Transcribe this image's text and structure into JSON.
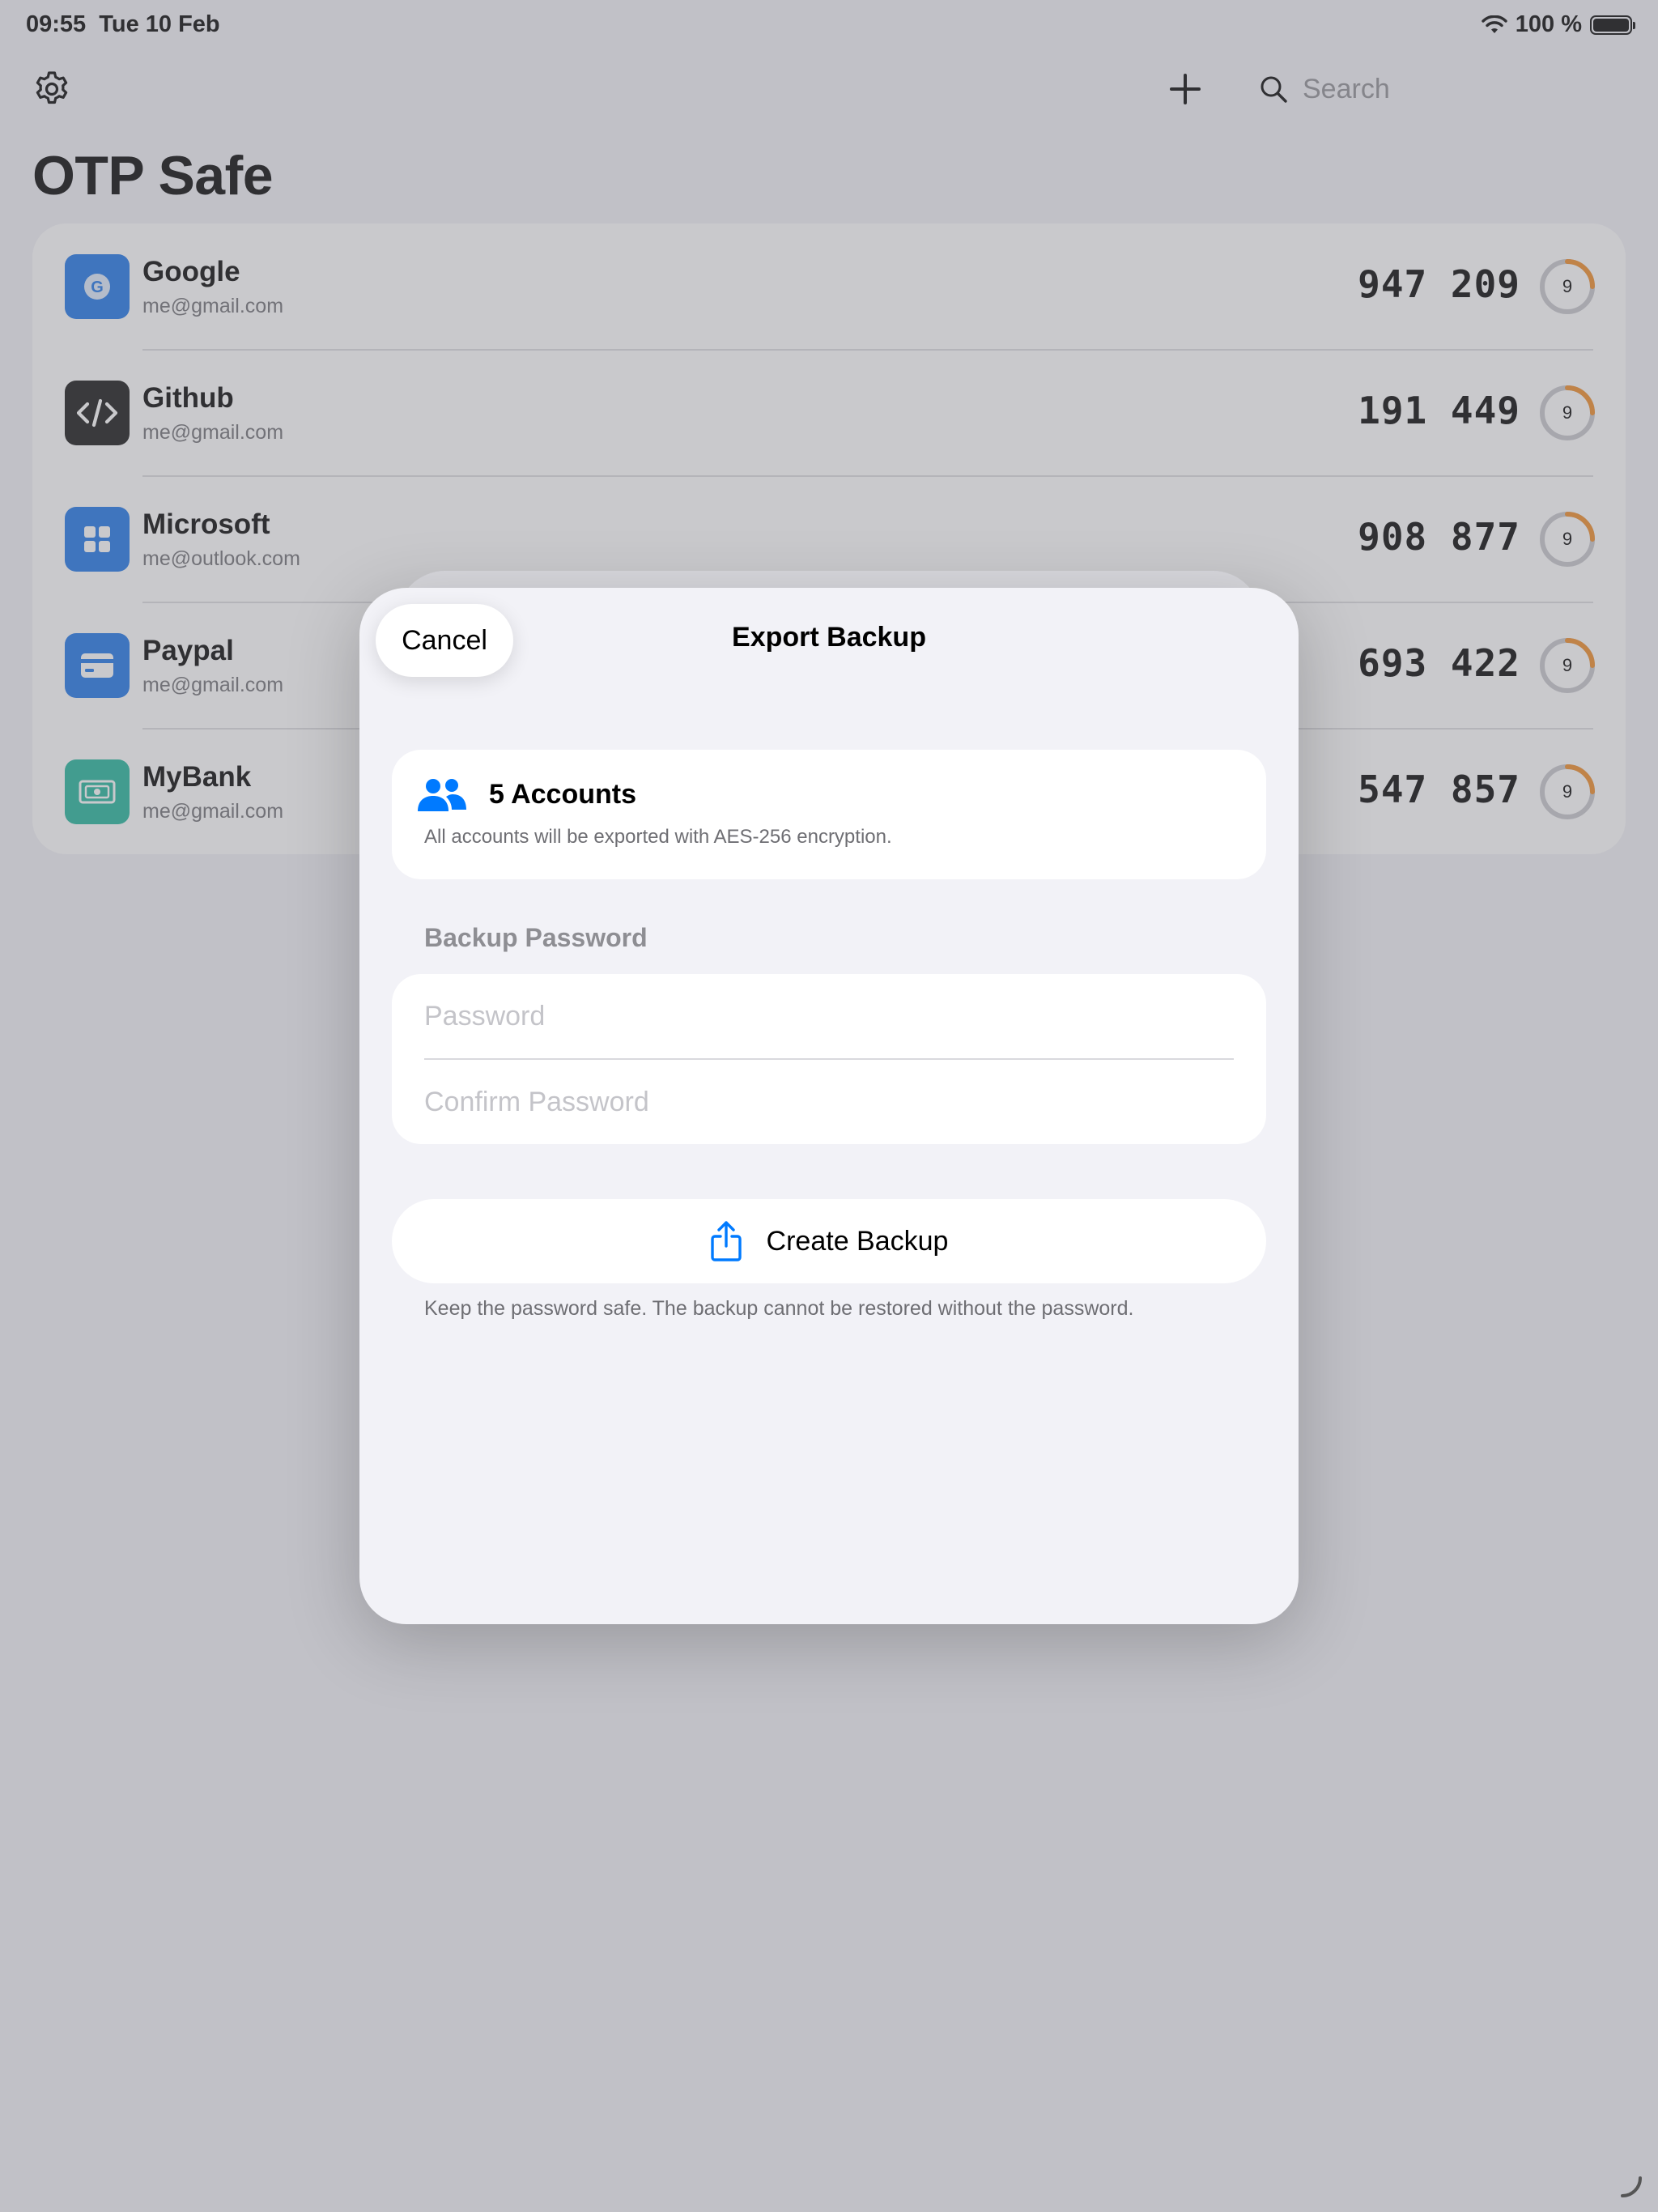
{
  "status_bar": {
    "time": "09:55",
    "date": "Tue 10 Feb",
    "battery": "100 %"
  },
  "toolbar": {
    "settings_icon": "gear-icon",
    "add_icon": "plus-icon",
    "search_placeholder": "Search"
  },
  "app_title": "OTP Safe",
  "accounts": [
    {
      "name": "Google",
      "email": "me@gmail.com",
      "code": "947 209",
      "seconds": "9",
      "icon": "google-icon",
      "icon_color": "#1a73e8"
    },
    {
      "name": "Github",
      "email": "me@gmail.com",
      "code": "191 449",
      "seconds": "9",
      "icon": "code-icon",
      "icon_color": "#111111"
    },
    {
      "name": "Microsoft",
      "email": "me@outlook.com",
      "code": "908 877",
      "seconds": "9",
      "icon": "grid-icon",
      "icon_color": "#1a73e8"
    },
    {
      "name": "Paypal",
      "email": "me@gmail.com",
      "code": "693 422",
      "seconds": "9",
      "icon": "card-icon",
      "icon_color": "#1a73e8"
    },
    {
      "name": "MyBank",
      "email": "me@gmail.com",
      "code": "547 857",
      "seconds": "9",
      "icon": "banknote-icon",
      "icon_color": "#1fb59a"
    }
  ],
  "sheet": {
    "cancel_label": "Cancel",
    "title": "Export Backup",
    "accounts_count_label": "5 Accounts",
    "accounts_note": "All accounts will be exported with AES-256 encryption.",
    "password_section_label": "Backup Password",
    "password_placeholder": "Password",
    "password_value": "",
    "confirm_placeholder": "Confirm Password",
    "confirm_value": "",
    "create_label": "Create Backup",
    "footnote": "Keep the password safe. The backup cannot be restored without the password."
  },
  "colors": {
    "accent": "#007aff",
    "timer": "#f08a24",
    "background": "#f2f2f7"
  }
}
